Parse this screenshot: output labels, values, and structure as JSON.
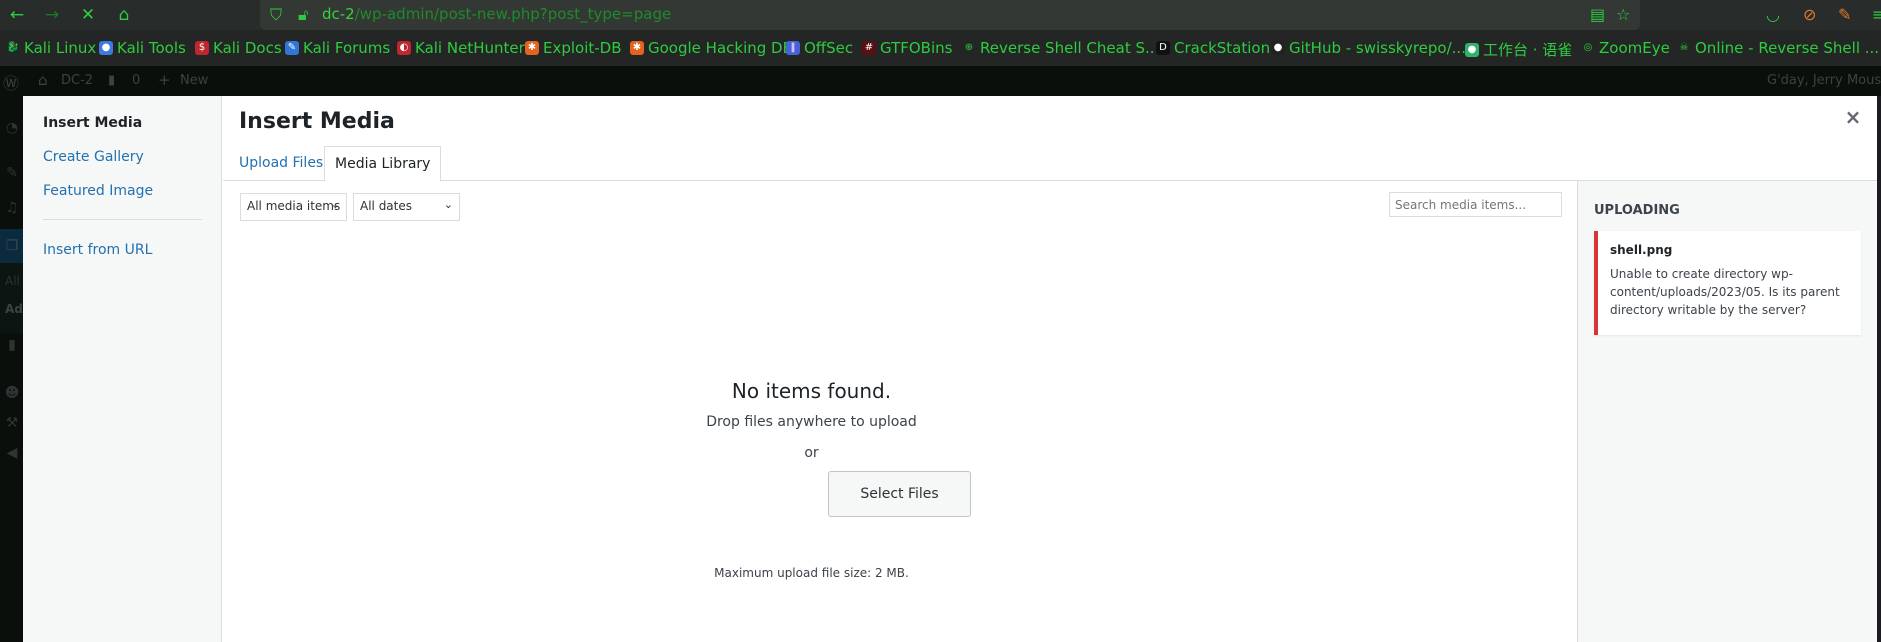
{
  "browser": {
    "url_host": "dc-2",
    "url_path": "/wp-admin/post-new.php?post_type=page",
    "bookmarks": [
      {
        "label": "Kali Linux",
        "icon": "kali-dragon-icon",
        "color": "#1e2a24",
        "glyph": "🐉"
      },
      {
        "label": "Kali Tools",
        "icon": "kali-tools-icon",
        "color": "#3a7be0",
        "glyph": "●"
      },
      {
        "label": "Kali Docs",
        "icon": "kali-docs-icon",
        "color": "#c0262d",
        "glyph": "$"
      },
      {
        "label": "Kali Forums",
        "icon": "kali-forums-icon",
        "color": "#2f76d6",
        "glyph": "✎"
      },
      {
        "label": "Kali NetHunter",
        "icon": "kali-nethunter-icon",
        "color": "#c0262d",
        "glyph": "◐"
      },
      {
        "label": "Exploit-DB",
        "icon": "exploit-db-bug-icon",
        "color": "#e2641e",
        "glyph": "✱"
      },
      {
        "label": "Google Hacking DB",
        "icon": "ghdb-bug-icon",
        "color": "#e2641e",
        "glyph": "✱"
      },
      {
        "label": "OffSec",
        "icon": "offsec-icon",
        "color": "#4a5fd8",
        "glyph": "‖"
      },
      {
        "label": "GTFOBins",
        "icon": "gtfobins-icon",
        "color": "#5a0f12",
        "glyph": "#"
      },
      {
        "label": "Reverse Shell Cheat S...",
        "icon": "globe-icon",
        "color": "transparent",
        "glyph": "⊕"
      },
      {
        "label": "CrackStation",
        "icon": "crackstation-icon",
        "color": "#111",
        "glyph": "D"
      },
      {
        "label": "GitHub - swisskyrepo/...",
        "icon": "github-icon",
        "color": "#222",
        "glyph": "●"
      },
      {
        "label": "工作台 · 语雀",
        "icon": "yuque-icon",
        "color": "#2db36a",
        "glyph": "●"
      },
      {
        "label": "ZoomEye",
        "icon": "zoomeye-icon",
        "color": "transparent",
        "glyph": "◎"
      },
      {
        "label": "Online - Reverse Shell ...",
        "icon": "skull-icon",
        "color": "transparent",
        "glyph": "☠"
      }
    ]
  },
  "adminbar": {
    "site_name": "DC-2",
    "comments_count": "0",
    "new_label": "New",
    "greeting": "G'day, Jerry Mouse"
  },
  "wpsidebar": {
    "sub_all": "All",
    "sub_add": "Add"
  },
  "modal": {
    "menu": {
      "insert_media": "Insert Media",
      "create_gallery": "Create Gallery",
      "featured_image": "Featured Image",
      "insert_from_url": "Insert from URL"
    },
    "title": "Insert Media",
    "close_label": "×",
    "tabs": {
      "upload_files": "Upload Files",
      "media_library": "Media Library"
    },
    "filters": {
      "type_selected": "All media items",
      "date_selected": "All dates",
      "search_placeholder": "Search media items..."
    },
    "empty": {
      "heading": "No items found.",
      "drop": "Drop files anywhere to upload",
      "or": "or",
      "select_files": "Select Files",
      "max_size": "Maximum upload file size: 2 MB."
    },
    "uploading": {
      "heading": "UPLOADING",
      "filename": "shell.png",
      "error": "Unable to create directory wp-content/uploads/2023/05. Is its parent directory writable by the server?",
      "error_color": "#d63638"
    }
  }
}
